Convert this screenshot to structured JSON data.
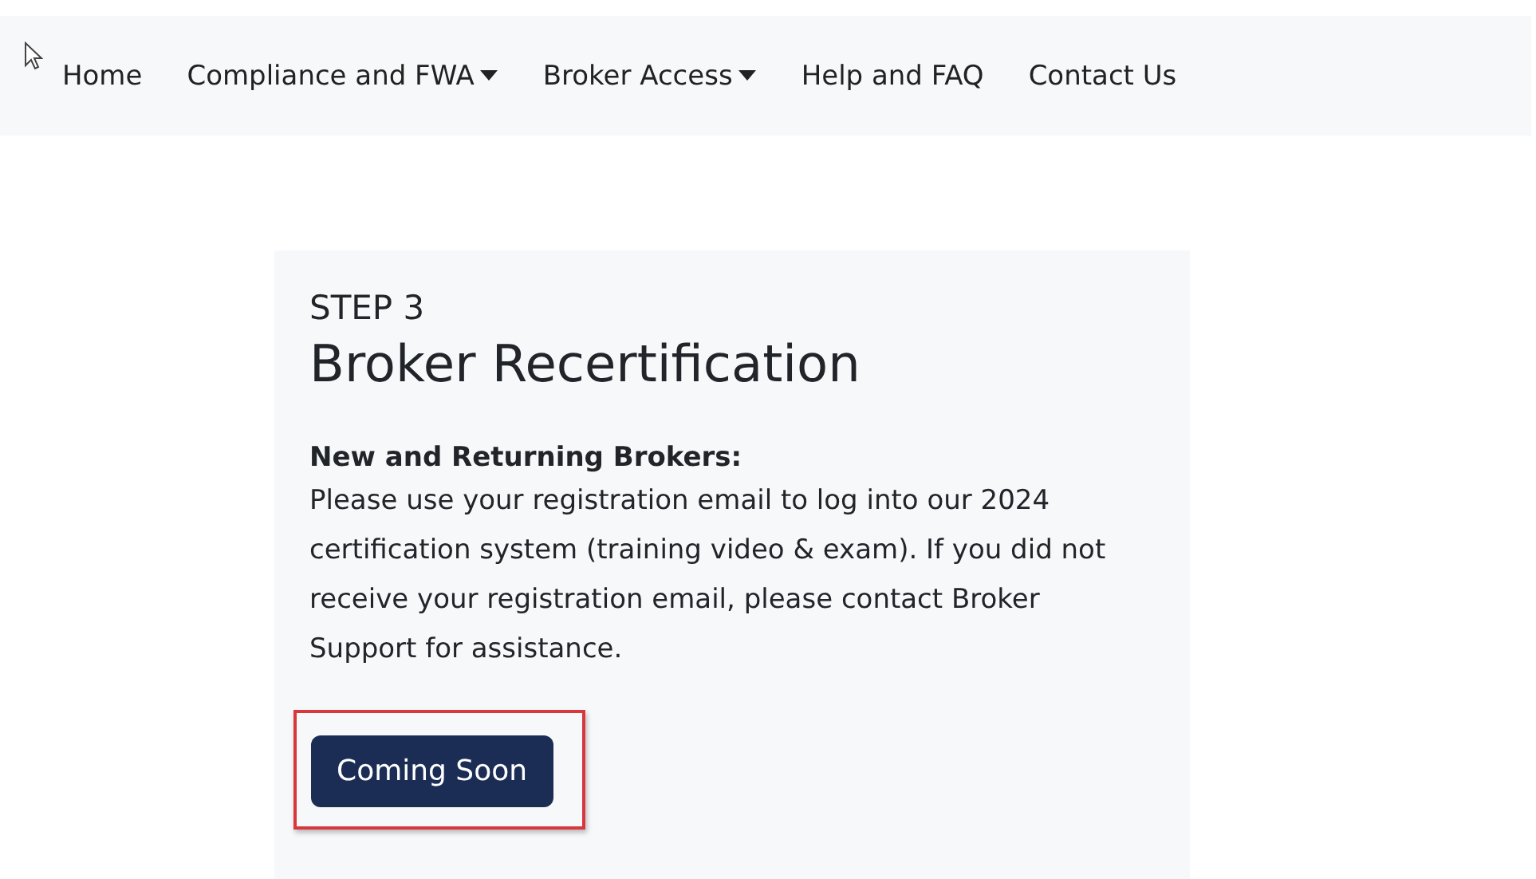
{
  "nav": {
    "items": [
      {
        "label": "Home",
        "dropdown": false
      },
      {
        "label": "Compliance and FWA",
        "dropdown": true
      },
      {
        "label": "Broker Access",
        "dropdown": true
      },
      {
        "label": "Help and FAQ",
        "dropdown": false
      },
      {
        "label": "Contact Us",
        "dropdown": false
      }
    ]
  },
  "card": {
    "step": "STEP 3",
    "title": "Broker Recertification",
    "subheading": "New and Returning Brokers:",
    "body": "Please use your registration email to log into our 2024 certification system (training video & exam). If you did not receive your registration email, please contact Broker Support for assistance.",
    "button": {
      "label": "Coming Soon",
      "highlighted": true
    }
  }
}
